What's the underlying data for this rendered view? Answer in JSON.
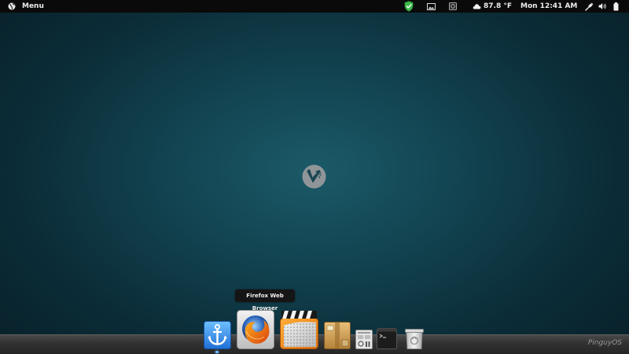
{
  "top_panel": {
    "menu_label": "Menu",
    "weather": "87.8 °F",
    "clock": "Mon 12:41 AM"
  },
  "tooltip": {
    "text": "Firefox Web Browser"
  },
  "dock": {
    "items": [
      {
        "name": "dock-anchor-icon"
      },
      {
        "name": "firefox-icon"
      },
      {
        "name": "media-player-icon"
      },
      {
        "name": "archive-manager-icon"
      },
      {
        "name": "system-settings-icon"
      },
      {
        "name": "terminal-icon"
      },
      {
        "name": "trash-icon"
      }
    ]
  },
  "brand": "PinguyOS",
  "colors": {
    "panel_bg": "#0a0a0a",
    "desktop_center": "#1b5a68",
    "desktop_edge": "#071c24",
    "shield_green": "#3db94a",
    "dock_active_indicator": "#6fb8ff"
  }
}
